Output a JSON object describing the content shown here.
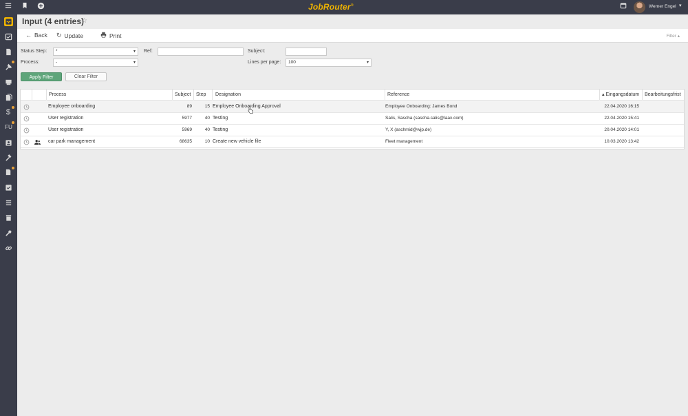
{
  "topbar": {
    "brand": "JobRouter",
    "brand_mark": "®",
    "user_name": "Werner Engel",
    "icons": [
      "menu-icon",
      "bookmark-icon",
      "add-icon",
      "calendar-icon",
      "user-caret-icon"
    ]
  },
  "sidebar": {
    "items": [
      {
        "icon": "inbox-icon",
        "active": true,
        "badge": false
      },
      {
        "icon": "tray-icon",
        "active": false,
        "badge": false
      },
      {
        "icon": "document-icon",
        "active": false,
        "badge": false
      },
      {
        "icon": "tools-icon",
        "active": false,
        "badge": true
      },
      {
        "icon": "tag-icon",
        "active": false,
        "badge": false
      },
      {
        "icon": "folder-icon",
        "active": false,
        "badge": false
      },
      {
        "icon": "dollar-icon",
        "active": false,
        "badge": true
      },
      {
        "icon": "fu-icon",
        "label": "FU",
        "active": false,
        "badge": true
      },
      {
        "icon": "contacts-icon",
        "active": false,
        "badge": false
      },
      {
        "icon": "hammer-icon",
        "active": false,
        "badge": false
      },
      {
        "icon": "files-icon",
        "active": false,
        "badge": true
      },
      {
        "icon": "tasks-icon",
        "active": false,
        "badge": false
      },
      {
        "icon": "list-icon",
        "active": false,
        "badge": false
      },
      {
        "icon": "archive-icon",
        "active": false,
        "badge": false
      },
      {
        "icon": "wrench-icon",
        "active": false,
        "badge": false
      },
      {
        "icon": "link-icon",
        "active": false,
        "badge": false
      }
    ]
  },
  "page": {
    "title": "Input (4 entries)",
    "star": "☆"
  },
  "toolbar": {
    "back_label": "Back",
    "update_label": "Update",
    "print_label": "Print",
    "filter_toggle": "Filter"
  },
  "filter": {
    "status_step_label": "Status Step:",
    "status_step_value": "*",
    "process_label": "Process:",
    "process_value": "-",
    "ref_label": "Ref:",
    "ref_value": "",
    "subject_label": "Subject:",
    "subject_value": "",
    "lines_per_page_label": "Lines per page:",
    "lines_per_page_value": "100",
    "apply_label": "Apply Filter",
    "clear_label": "Clear Filter"
  },
  "table": {
    "columns": {
      "process": "Process",
      "subject": "Subject",
      "step": "Step",
      "designation": "Designation",
      "reference": "Reference",
      "eingangsdatum": "Eingangsdatum",
      "sort_indicator": "▴",
      "bearbeitungsfrist": "Bearbeitungsfrist"
    },
    "rows": [
      {
        "process": "Employee onboarding",
        "subject": "89",
        "step": "15",
        "designation": "Employee Onboarding Approval",
        "reference": "Employee Onboarding: James Bond",
        "date": "22.04.2020 16:15",
        "deadline": "",
        "has_user_icon": false
      },
      {
        "process": "User registration",
        "subject": "5977",
        "step": "40",
        "designation": "Testing",
        "reference": "Salis, Sascha (sascha.salis@laax.com)",
        "date": "22.04.2020 15:41",
        "deadline": "",
        "has_user_icon": false
      },
      {
        "process": "User registration",
        "subject": "5969",
        "step": "40",
        "designation": "Testing",
        "reference": "Y, X (aschmid@wjp.de)",
        "date": "20.04.2020 14:01",
        "deadline": "",
        "has_user_icon": false
      },
      {
        "process": "car park management",
        "subject": "68635",
        "step": "10",
        "designation": "Create new vehicle file",
        "reference": "Fleet management",
        "date": "10.03.2020 13:42",
        "deadline": "",
        "has_user_icon": true
      }
    ]
  },
  "colors": {
    "sidebar_bg": "#3a3d4a",
    "brand": "#f0b400",
    "apply_button": "#5ea57a",
    "badge": "#e8a23a"
  }
}
